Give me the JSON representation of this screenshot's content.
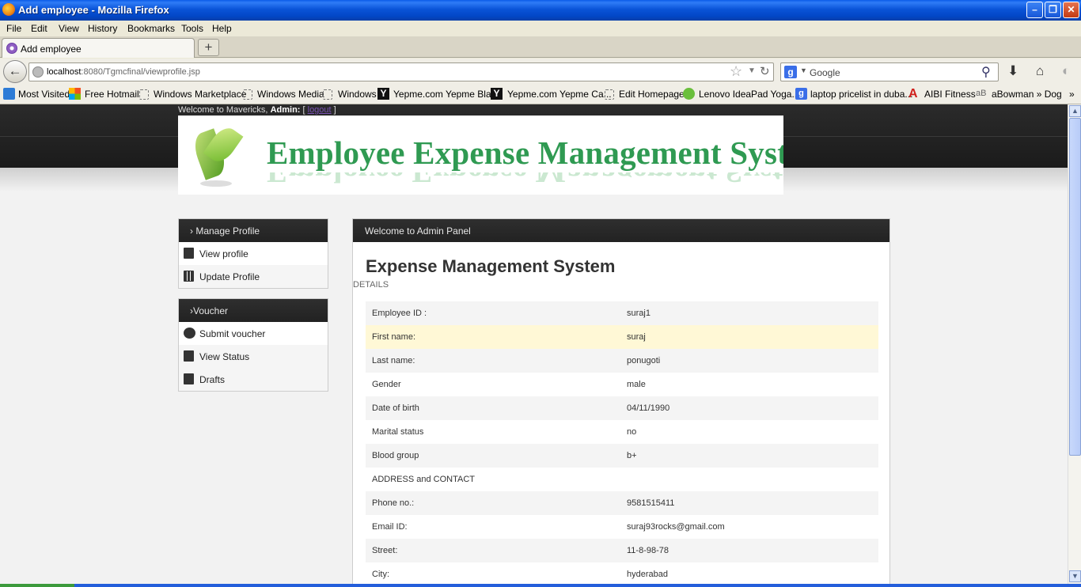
{
  "window": {
    "title": "Add employee - Mozilla Firefox",
    "controls": [
      "minimize",
      "restore",
      "close"
    ]
  },
  "menu": [
    "File",
    "Edit",
    "View",
    "History",
    "Bookmarks",
    "Tools",
    "Help"
  ],
  "tab": {
    "label": "Add employee",
    "new_tab_symbol": "+"
  },
  "nav": {
    "url_host": "localhost",
    "url_rest": ":8080/Tgmcfinal/viewprofile.jsp",
    "search_placeholder": "Google",
    "search_engine_letter": "g"
  },
  "bookmarks": [
    {
      "label": "Most Visited",
      "icon": "most-visited-icon"
    },
    {
      "label": "Free Hotmail",
      "icon": "windows-logo-icon"
    },
    {
      "label": "Windows Marketplace",
      "icon": "blank-page-icon"
    },
    {
      "label": "Windows Media",
      "icon": "blank-page-icon"
    },
    {
      "label": "Windows",
      "icon": "blank-page-icon"
    },
    {
      "label": "Yepme.com Yepme Bla...",
      "icon": "yepme-icon"
    },
    {
      "label": "Yepme.com Yepme Ca...",
      "icon": "yepme-icon"
    },
    {
      "label": "Edit Homepage",
      "icon": "blank-page-icon"
    },
    {
      "label": "Lenovo IdeaPad Yoga...",
      "icon": "lenovo-icon"
    },
    {
      "label": "laptop pricelist in duba...",
      "icon": "google-icon"
    },
    {
      "label": "AIBI Fitness",
      "icon": "aibi-icon"
    },
    {
      "label": "aBowman » Dog",
      "icon": "abowman-icon"
    }
  ],
  "bookmarks_overflow": "»",
  "page": {
    "welcome_prefix": "Welcome to Mavericks,",
    "welcome_role": "Admin:",
    "logout_label": "logout",
    "banner_title": "Employee Expense Management System",
    "sidebar": {
      "profile_heading": "› Manage Profile",
      "profile_items": [
        "View profile",
        "Update Profile"
      ],
      "voucher_heading": "›Voucher",
      "voucher_items": [
        "Submit voucher",
        "View Status",
        "Drafts"
      ]
    },
    "panel": {
      "heading": "Welcome to Admin Panel",
      "title": "Expense Management System",
      "details_label": "DETAILS",
      "rows": [
        {
          "key": "Employee ID :",
          "value": "suraj1"
        },
        {
          "key": "First name:",
          "value": "suraj"
        },
        {
          "key": "Last name:",
          "value": "ponugoti"
        },
        {
          "key": "Gender",
          "value": "male"
        },
        {
          "key": "Date of birth",
          "value": "04/11/1990"
        },
        {
          "key": "Marital status",
          "value": "no"
        },
        {
          "key": "Blood group",
          "value": "b+"
        },
        {
          "key": "ADDRESS and CONTACT",
          "value": ""
        },
        {
          "key": "Phone no.:",
          "value": "9581515411"
        },
        {
          "key": "Email ID:",
          "value": "suraj93rocks@gmail.com"
        },
        {
          "key": "Street:",
          "value": "11-8-98-78"
        },
        {
          "key": "City:",
          "value": "hyderabad"
        }
      ]
    }
  },
  "colors": {
    "titlebar": "#0a54d8",
    "banner_text": "#2f9a52",
    "panel_header": "#2a2a2a",
    "highlight_row": "#fff8d6"
  }
}
